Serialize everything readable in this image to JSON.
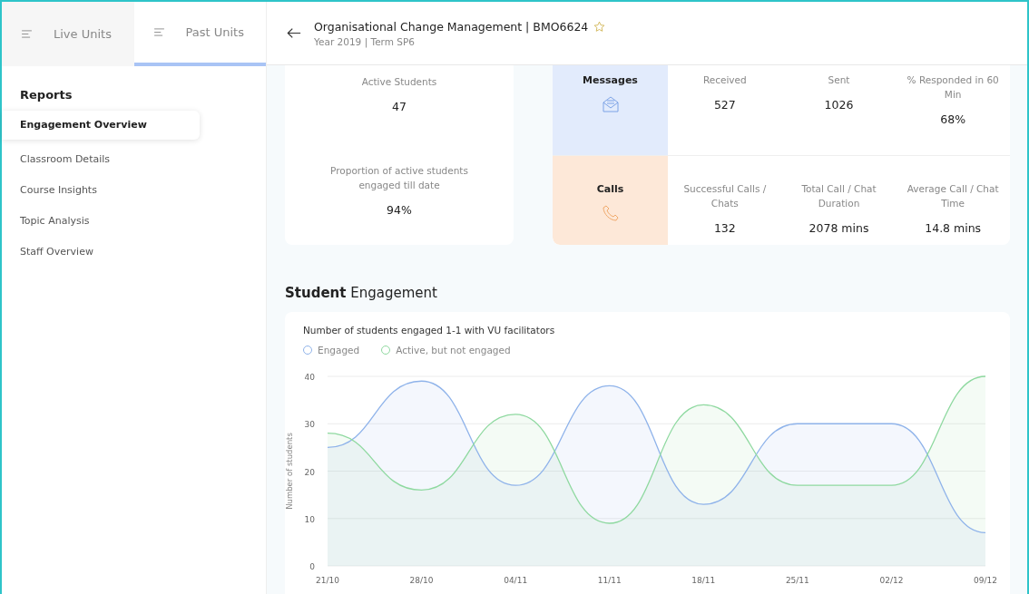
{
  "sidebar": {
    "tabs": [
      {
        "label": "Live Units",
        "selected": false
      },
      {
        "label": "Past Units",
        "selected": true
      }
    ],
    "section_title": "Reports",
    "items": [
      {
        "label": "Engagement Overview",
        "selected": true
      },
      {
        "label": "Classroom Details",
        "selected": false
      },
      {
        "label": "Course Insights",
        "selected": false
      },
      {
        "label": "Topic Analysis",
        "selected": false
      },
      {
        "label": "Staff Overview",
        "selected": false
      }
    ]
  },
  "header": {
    "title": "Organisational Change Management | BMO6624",
    "subtitle": "Year 2019 | Term SP6",
    "starred": false
  },
  "summary": [
    {
      "label": "Active Students",
      "value": "47"
    },
    {
      "label": "Proportion of active students engaged till date",
      "value": "94%"
    }
  ],
  "channels": [
    {
      "kind": "messages",
      "name": "Messages",
      "stats": [
        {
          "label": "Received",
          "value": "527"
        },
        {
          "label": "Sent",
          "value": "1026"
        },
        {
          "label": "% Responded in 60 Min",
          "value": "68%"
        }
      ]
    },
    {
      "kind": "calls",
      "name": "Calls",
      "stats": [
        {
          "label": "Successful Calls / Chats",
          "value": "132"
        },
        {
          "label": "Total Call / Chat Duration",
          "value": "2078 mins"
        },
        {
          "label": "Average Call / Chat Time",
          "value": "14.8 mins"
        }
      ]
    }
  ],
  "engagement": {
    "heading": "**Student** Engagement",
    "chart_data": {
      "type": "area",
      "title": "Number of students engaged 1-1 with VU facilitators",
      "ylabel": "Number of students",
      "categories": [
        "21/10",
        "28/10",
        "04/11",
        "11/11",
        "18/11",
        "25/11",
        "02/12",
        "09/12"
      ],
      "series": [
        {
          "name": "Engaged",
          "color": "#8fb3ea",
          "values": [
            25,
            39,
            17,
            38,
            13,
            30,
            30,
            7
          ]
        },
        {
          "name": "Active, but not engaged",
          "color": "#8fd9a0",
          "values": [
            28,
            16,
            32,
            9,
            34,
            17,
            17,
            40
          ]
        }
      ],
      "ylim": [
        0,
        40
      ],
      "yticks": [
        0,
        10,
        20,
        30,
        40
      ],
      "grid": true
    }
  }
}
